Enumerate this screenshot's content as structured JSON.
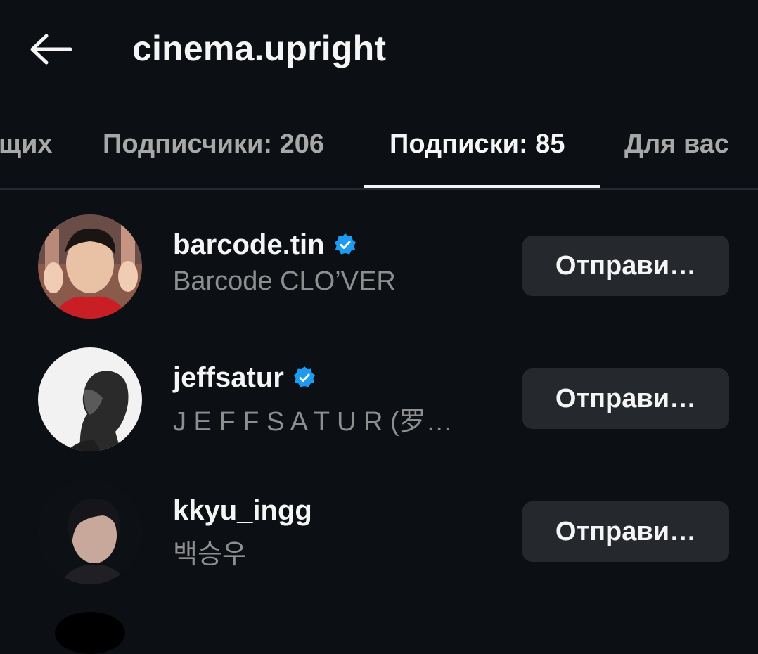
{
  "header": {
    "title": "cinema.upright",
    "back_icon": "arrow-left-icon"
  },
  "tabs": [
    {
      "label": "щих",
      "active": false
    },
    {
      "label": "Подписчики: 206",
      "active": false
    },
    {
      "label": "Подписки: 85",
      "active": true
    },
    {
      "label": "Для вас",
      "active": false
    }
  ],
  "users": [
    {
      "username": "barcode.tin",
      "verified": true,
      "full_name": "Barcode CLO’VER",
      "button": "Отправи…"
    },
    {
      "username": "jeffsatur",
      "verified": true,
      "full_name": "J E F F  S A T U R (罗…",
      "button": "Отправи…"
    },
    {
      "username": "kkyu_ingg",
      "verified": false,
      "full_name": "백승우",
      "button": "Отправи…"
    }
  ],
  "colors": {
    "background": "#0c1014",
    "button": "#25292e",
    "verified": "#1d9bf0",
    "muted": "#8e8e8e"
  }
}
